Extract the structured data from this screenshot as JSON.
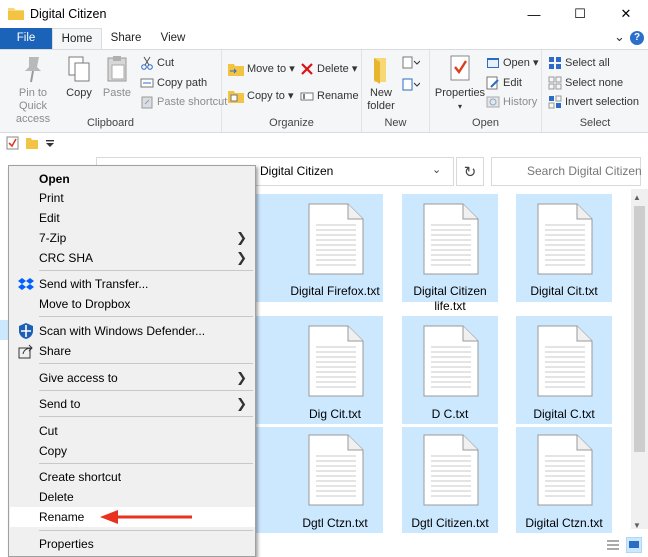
{
  "window": {
    "title": "Digital Citizen",
    "minimize_glyph": "—",
    "maximize_glyph": "☐",
    "close_glyph": "✕"
  },
  "ribbon_tabs": [
    "File",
    "Home",
    "Share",
    "View"
  ],
  "ribbon_controls": {
    "collapse_glyph": "⌄",
    "help_glyph": "?"
  },
  "ribbon": {
    "clipboard": {
      "label": "Clipboard",
      "pin": "Pin to Quick access",
      "copy": "Copy",
      "paste": "Paste",
      "cut": "Cut",
      "copy_path": "Copy path",
      "paste_shortcut": "Paste shortcut"
    },
    "organize": {
      "label": "Organize",
      "move_to": "Move to",
      "copy_to": "Copy to",
      "delete": "Delete",
      "rename": "Rename"
    },
    "new": {
      "label": "New",
      "new_folder": "New folder"
    },
    "open": {
      "label": "Open",
      "properties": "Properties",
      "open": "Open",
      "edit": "Edit",
      "history": "History"
    },
    "select": {
      "label": "Select",
      "select_all": "Select all",
      "select_none": "Select none",
      "invert_selection": "Invert selection"
    }
  },
  "address": {
    "path": "Digital Citizen",
    "search_placeholder": "Search Digital Citizen"
  },
  "files": [
    "Digital Firefox.txt",
    "Digital Citizen life.txt",
    "Digital Cit.txt",
    "Dig Cit.txt",
    "D C.txt",
    "Digital C.txt",
    "Dgtl Ctzn.txt",
    "Dgtl Citizen.txt",
    "Digital Ctzn.txt"
  ],
  "context_menu": {
    "open": "Open",
    "print": "Print",
    "edit": "Edit",
    "zip": "7-Zip",
    "crc": "CRC SHA",
    "send_transfer": "Send with Transfer...",
    "move_dropbox": "Move to Dropbox",
    "scan_defender": "Scan with Windows Defender...",
    "share": "Share",
    "give_access": "Give access to",
    "send_to": "Send to",
    "cut": "Cut",
    "copy": "Copy",
    "create_shortcut": "Create shortcut",
    "delete": "Delete",
    "rename": "Rename",
    "properties": "Properties"
  },
  "colors": {
    "accent_file_tab": "#1a63b8",
    "selection": "#cce8ff",
    "arrow": "#e8321f",
    "menu_bg": "#f0f0f0"
  },
  "icons": {
    "folder": "folder-icon",
    "dropbox": "dropbox-icon",
    "defender": "windows-defender-icon",
    "share": "share-icon",
    "search": "search-icon",
    "refresh": "refresh-icon"
  }
}
